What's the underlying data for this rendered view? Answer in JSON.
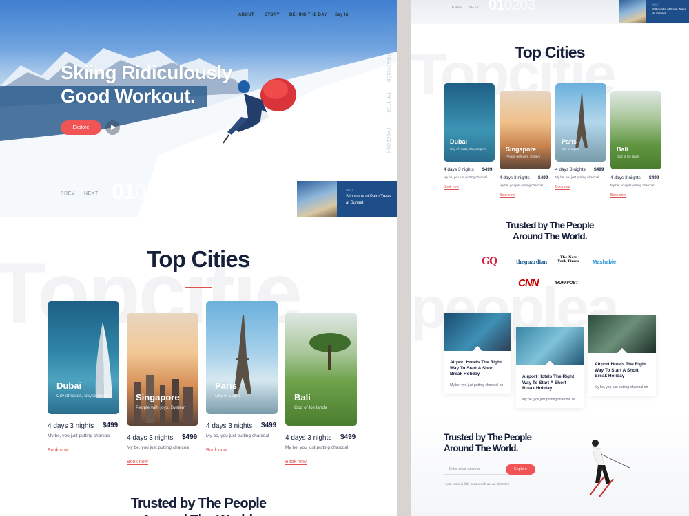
{
  "hero": {
    "nav": [
      "ABOUT",
      "STORY",
      "BEHIND THE DAY",
      "Say hi!"
    ],
    "title": "Skiing Ridiculously Good Workout.",
    "explore_label": "Explore",
    "social": [
      "TRIPADVISOR",
      "TWITTER",
      "FACEBOOK"
    ],
    "prev_label": "PREV",
    "next_label": "NEXT",
    "slides": [
      "01",
      "02",
      "03"
    ],
    "next_card": {
      "label": "NEXT",
      "title": "Silhouette of Palm Trees at Sunset"
    }
  },
  "top_cities": {
    "ghost_text": "Topcitie",
    "title": "Top Cities",
    "cities": [
      {
        "name": "Dubai",
        "subtitle": "City of roads, Skyscrapers",
        "nights": "4 days 3 nights",
        "price": "$499",
        "desc": "My be, you just putting charcoal",
        "book": "Book now"
      },
      {
        "name": "Singapore",
        "subtitle": "People with joys, System",
        "nights": "4 days 3 nights",
        "price": "$499",
        "desc": "My be, you just putting charcoal",
        "book": "Book now"
      },
      {
        "name": "Paris",
        "subtitle": "City of Lights",
        "nights": "4 days 3 nights",
        "price": "$499",
        "desc": "My be, you just putting charcoal",
        "book": "Book now"
      },
      {
        "name": "Bali",
        "subtitle": "God of Ice lands",
        "nights": "4 days 3 nights",
        "price": "$499",
        "desc": "My be, you just putting charcoal",
        "book": "Book now"
      }
    ]
  },
  "trusted": {
    "title_line1": "Trusted by The People",
    "title_line2": "Around The World.",
    "ghost_text": "peoplea",
    "logos": [
      "GQ",
      "theguardian",
      "The New York Times",
      "Mashable",
      "CNN",
      "IHUFFPOST"
    ]
  },
  "blog": [
    {
      "title": "Airport Hotels The Right Way To Start A Short Break Holiday",
      "desc": "My be, you just putting charcoal on"
    },
    {
      "title": "Airport Hotels The Right Way To Start A Short Break Holiday",
      "desc": "My be, you just putting charcoal on"
    },
    {
      "title": "Airport Hotels The Right Way To Start A Short Break Holiday",
      "desc": "My be, you just putting charcoal on"
    }
  ],
  "newsletter": {
    "title_line1": "Trusted by The People",
    "title_line2": "Around The World.",
    "placeholder": "Enter email address",
    "button": "Explore",
    "note": "* your email is fully secure with us. we don't sell"
  },
  "colors": {
    "accent": "#f05454",
    "navy": "#17203a",
    "brand_blue": "#1e4e89"
  }
}
